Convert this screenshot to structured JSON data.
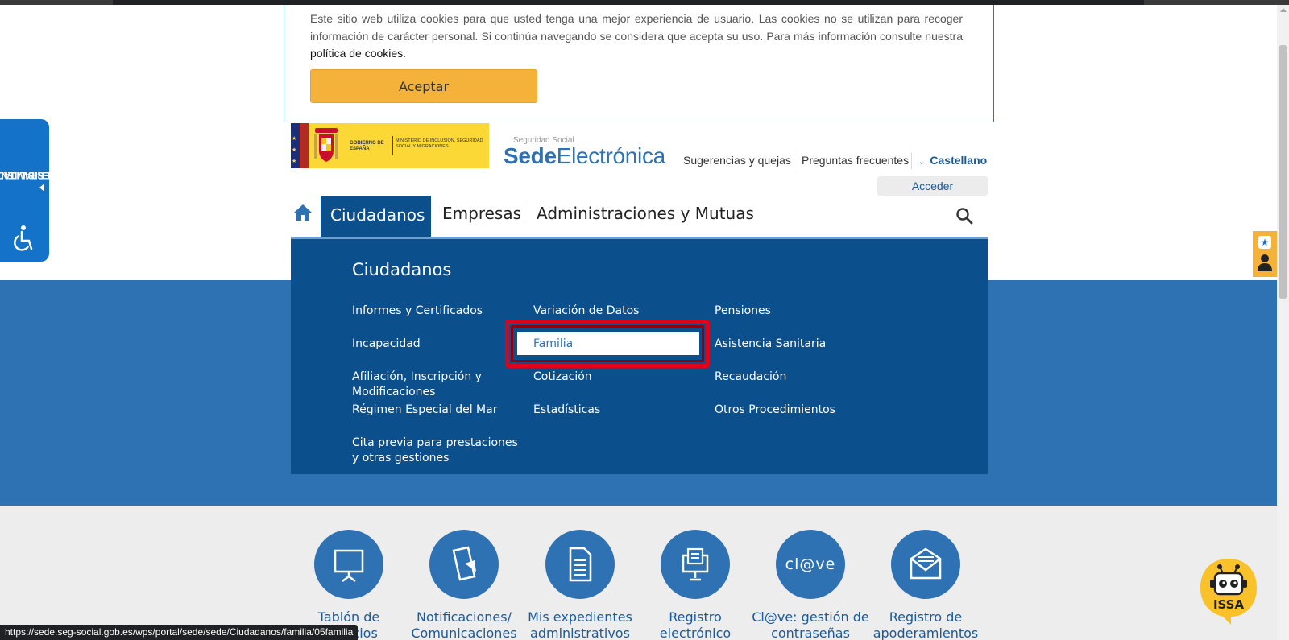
{
  "cookie": {
    "text": "Este sitio web utiliza cookies para que usted tenga una mejor experiencia de usuario. Las cookies no se utilizan para recoger información de carácter personal. Si continúa navegando se considera que acepta su uso. Para más información consulte nuestra",
    "link": "política de cookies",
    "end": ".",
    "accept_label": "Aceptar"
  },
  "accessibility": {
    "line1": "HERRAMIENTAS DE",
    "line2": "ACCESIBILIDAD"
  },
  "header": {
    "gov_logo_text": "GOBIERNO DE ESPAÑA",
    "ministry_text": "MINISTERIO DE INCLUSIÓN, SEGURIDAD SOCIAL Y MIGRACIONES",
    "brand_small": "Seguridad Social",
    "brand_bold": "Sede",
    "brand_light": "Electrónica",
    "links": [
      "Sugerencias y quejas",
      "Preguntas frecuentes"
    ],
    "language": "Castellano",
    "login_label": "Acceder"
  },
  "nav": {
    "tabs": [
      {
        "label": "Ciudadanos",
        "active": true
      },
      {
        "label": "Empresas",
        "active": false
      },
      {
        "label": "Administraciones y Mutuas",
        "active": false
      }
    ]
  },
  "mega_menu": {
    "title": "Ciudadanos",
    "items": [
      "Informes y Certificados",
      "Variación de Datos",
      "Pensiones",
      "Incapacidad",
      "Familia",
      "Asistencia Sanitaria",
      "Afiliación, Inscripción y Modificaciones",
      "Cotización",
      "Recaudación",
      "Régimen Especial del Mar",
      "Estadísticas",
      "Otros Procedimientos",
      "Cita previa para prestaciones y otras gestiones"
    ],
    "highlighted": "Familia"
  },
  "services": [
    {
      "label": "Tablón de anuncios",
      "icon": "board-icon"
    },
    {
      "label": "Notificaciones/ Comunicaciones",
      "icon": "notifications-icon"
    },
    {
      "label": "Mis expedientes administrativos",
      "icon": "document-icon"
    },
    {
      "label": "Registro electrónico",
      "icon": "register-icon"
    },
    {
      "label": "Cl@ve: gestión de contraseñas",
      "icon": "clave-icon",
      "icon_text": "cl@ve"
    },
    {
      "label": "Registro de apoderamientos",
      "icon": "envelope-icon"
    }
  ],
  "assistant": {
    "name": "ISSA"
  },
  "status_url": "https://sede.seg-social.gob.es/wps/portal/sede/sede/Ciudadanos/familia/05familia",
  "colors": {
    "primary_blue": "#2e72b4",
    "dark_blue": "#0b4f8c",
    "accent_orange": "#f5b23b",
    "highlight_red": "#e1001a"
  }
}
